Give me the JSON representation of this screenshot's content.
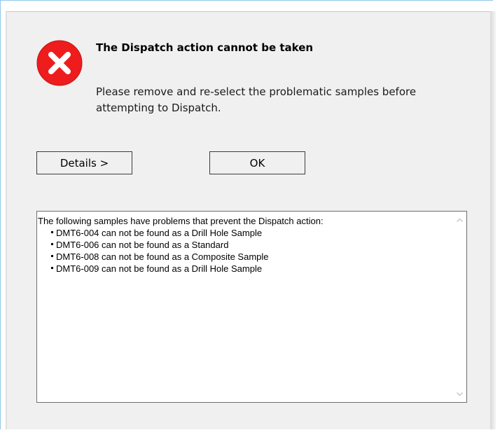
{
  "dialog": {
    "heading": "The Dispatch action cannot be taken",
    "message": "Please remove and re-select the problematic samples before attempting to Dispatch.",
    "icon": "error-icon",
    "icon_color": "#ee1c1c"
  },
  "buttons": {
    "details_label": "Details >",
    "ok_label": "OK"
  },
  "details": {
    "intro": "The following samples have problems that prevent the Dispatch action:",
    "samples": [
      "DMT6-004 can not be found as a Drill Hole Sample",
      "DMT6-006 can not be found as a Standard",
      "DMT6-008 can not be found as a Composite Sample",
      "DMT6-009 can not be found as a Drill Hole Sample"
    ]
  }
}
